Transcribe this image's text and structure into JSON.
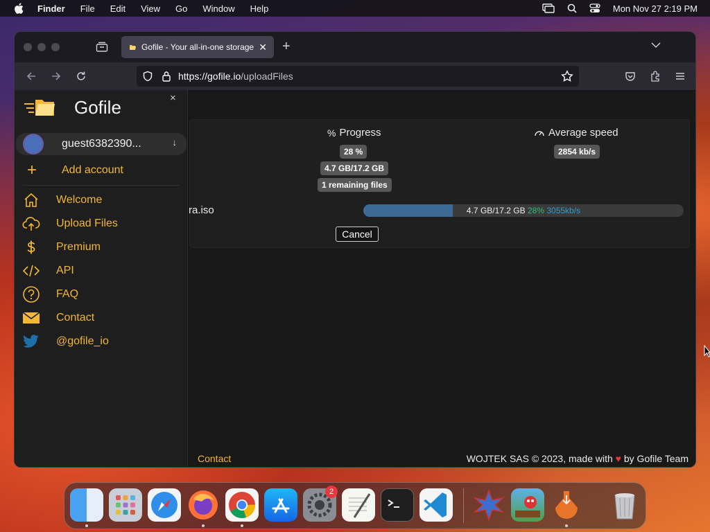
{
  "menubar": {
    "app_name": "Finder",
    "items": [
      "File",
      "Edit",
      "View",
      "Go",
      "Window",
      "Help"
    ],
    "datetime": "Mon Nov 27  2:19 PM"
  },
  "browser": {
    "tab_title": "Gofile - Your all-in-one storage",
    "url_host": "https://gofile.io",
    "url_path": "/uploadFiles"
  },
  "sidebar": {
    "brand": "Gofile",
    "close_glyph": "×",
    "account_name": "guest6382390...",
    "account_arrow": "↓",
    "add_account_glyph": "+",
    "add_account": "Add account",
    "items": [
      {
        "label": "Welcome",
        "icon": "home-icon"
      },
      {
        "label": "Upload Files",
        "icon": "cloud-upload-icon"
      },
      {
        "label": "Premium",
        "icon": "dollar-icon"
      },
      {
        "label": "API",
        "icon": "code-icon"
      },
      {
        "label": "FAQ",
        "icon": "question-icon"
      },
      {
        "label": "Contact",
        "icon": "envelope-icon"
      },
      {
        "label": "@gofile_io",
        "icon": "twitter-icon"
      }
    ]
  },
  "upload": {
    "progress_header": "Progress",
    "speed_header": "Average speed",
    "percent_badge": "28 %",
    "size_badge": "4.7 GB/17.2 GB",
    "remaining_badge": "1 remaining files",
    "speed_badge": "2854 kb/s",
    "file_name": "ra.iso",
    "bar_progress": 0.28,
    "bar_size": "4.7 GB/17.2 GB",
    "bar_percent": "28%",
    "bar_speed": "3055kb/s",
    "cancel": "Cancel"
  },
  "footer": {
    "contact": "Contact",
    "credit_prefix": "WOJTEK SAS © 2023, made with",
    "heart": "♥",
    "credit_suffix": "by Gofile Team"
  },
  "dock": {
    "apps": [
      "Finder",
      "Launchpad",
      "Safari",
      "Firefox",
      "Chrome",
      "App Store",
      "System Settings",
      "TextEdit",
      "Terminal",
      "VS Code",
      "Wireshark",
      "Game",
      "Installer",
      "Trash"
    ],
    "settings_badge": "2"
  },
  "colors": {
    "accent": "#f2b734",
    "progress_fill": "#3d6a94",
    "percent_green": "#2dbf7c",
    "speed_blue": "#2a9fd0"
  }
}
